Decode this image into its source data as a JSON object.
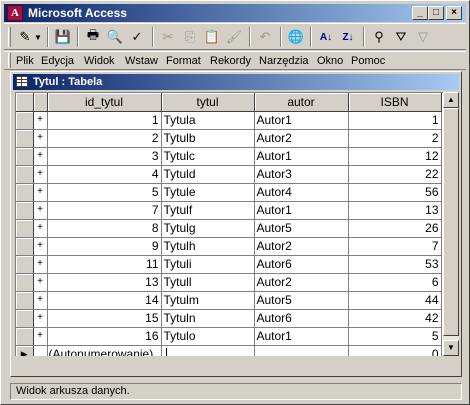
{
  "window": {
    "title": "Microsoft Access",
    "minimize": "_",
    "maximize": "□",
    "close": "×"
  },
  "toolbar": {
    "view_icon": "✎",
    "save_icon": "💾",
    "print_icon": "🖶",
    "preview_icon": "🔍",
    "spelling_icon": "✓",
    "cut_icon": "✂",
    "copy_icon": "⎘",
    "paste_icon": "📋",
    "format_painter_icon": "🖌",
    "undo_icon": "↶",
    "hyperlink_icon": "🌐",
    "sort_ascending_icon": "A↓",
    "sort_descending_icon": "Z↓",
    "filter_selection_icon": "⚲",
    "filter_form_icon": "⛛",
    "apply_filter_icon": "▽"
  },
  "menu": {
    "items": [
      "Plik",
      "Edycja",
      "Widok",
      "Wstaw",
      "Format",
      "Rekordy",
      "Narzędzia",
      "Okno",
      "Pomoc"
    ]
  },
  "table_window": {
    "title": "Tytul : Tabela"
  },
  "table": {
    "columns": [
      "id_tytul",
      "tytul",
      "autor",
      "ISBN"
    ],
    "rows": [
      {
        "id": "1",
        "tytul": "Tytula",
        "autor": "Autor1",
        "isbn": "1"
      },
      {
        "id": "2",
        "tytul": "Tytulb",
        "autor": "Autor2",
        "isbn": "2"
      },
      {
        "id": "3",
        "tytul": "Tytulc",
        "autor": "Autor1",
        "isbn": "12"
      },
      {
        "id": "4",
        "tytul": "Tytuld",
        "autor": "Autor3",
        "isbn": "22"
      },
      {
        "id": "5",
        "tytul": "Tytule",
        "autor": "Autor4",
        "isbn": "56"
      },
      {
        "id": "7",
        "tytul": "Tytulf",
        "autor": "Autor1",
        "isbn": "13"
      },
      {
        "id": "8",
        "tytul": "Tytulg",
        "autor": "Autor5",
        "isbn": "26"
      },
      {
        "id": "9",
        "tytul": "Tytulh",
        "autor": "Autor2",
        "isbn": "7"
      },
      {
        "id": "11",
        "tytul": "Tytuli",
        "autor": "Autor6",
        "isbn": "53"
      },
      {
        "id": "13",
        "tytul": "Tytull",
        "autor": "Autor2",
        "isbn": "6"
      },
      {
        "id": "14",
        "tytul": "Tytulm",
        "autor": "Autor5",
        "isbn": "44"
      },
      {
        "id": "15",
        "tytul": "Tytuln",
        "autor": "Autor6",
        "isbn": "42"
      },
      {
        "id": "16",
        "tytul": "Tytulo",
        "autor": "Autor1",
        "isbn": "5"
      }
    ],
    "expand_symbol": "+",
    "new_row": {
      "id": "(Autonumerowanie)",
      "isbn": "0"
    },
    "current_row_marker": "▶"
  },
  "statusbar": {
    "text": "Widok arkusza danych."
  }
}
